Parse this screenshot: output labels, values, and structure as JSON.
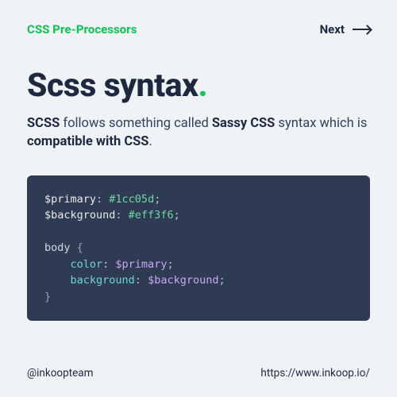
{
  "header": {
    "topic": "CSS Pre-Processors",
    "next_label": "Next"
  },
  "title": "Scss syntax",
  "dot": ".",
  "desc": {
    "p1": "SCSS",
    "p2": " follows something called ",
    "p3": "Sassy CSS",
    "p4": " syntax which is ",
    "p5": "compatible with CSS",
    "p6": "."
  },
  "code": {
    "l1_var": "$primary",
    "l1_colon": ": ",
    "l1_val": "#1cc05d",
    "l1_semi": ";",
    "l2_var": "$background",
    "l2_colon": ": ",
    "l2_val": "#eff3f6",
    "l2_semi": ";",
    "blank": "",
    "l3_sel": "body ",
    "l3_brace": "{",
    "l4_indent": "    ",
    "l4_prop": "color",
    "l4_colon": ": ",
    "l4_val": "$primary",
    "l4_semi": ";",
    "l5_indent": "    ",
    "l5_prop": "background",
    "l5_colon": ": ",
    "l5_val": "$background",
    "l5_semi": ";",
    "l6_brace": "}"
  },
  "footer": {
    "handle": "@inkoopteam",
    "url": "https://www.inkoop.io/"
  },
  "colors": {
    "accent": "#1cc05d",
    "bg": "#eff3f6",
    "code_bg": "#2f3b52"
  }
}
